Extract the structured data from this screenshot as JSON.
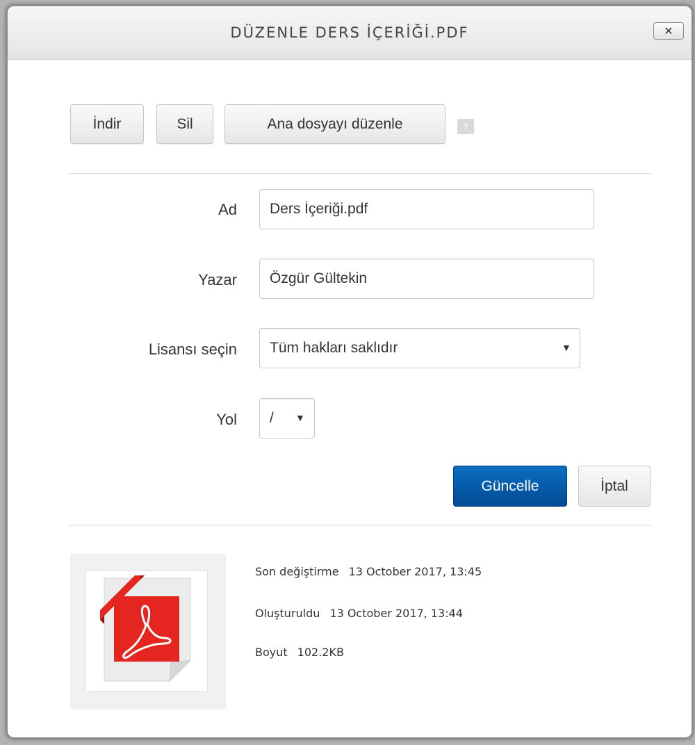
{
  "dialog": {
    "title": "DÜZENLE DERS İÇERİĞİ.PDF",
    "close_label": "✕"
  },
  "toolbar": {
    "download_label": "İndir",
    "delete_label": "Sil",
    "set_main_label": "Ana dosyayı düzenle",
    "help_icon": "question-icon",
    "help_glyph": "?"
  },
  "form": {
    "name_label": "Ad",
    "name_value": "Ders İçeriği.pdf",
    "author_label": "Yazar",
    "author_value": "Özgür Gültekin",
    "license_label": "Lisansı seçin",
    "license_value": "Tüm hakları saklıdır",
    "path_label": "Yol",
    "path_value": "/",
    "dropdown_arrow": "▼"
  },
  "actions": {
    "update_label": "Güncelle",
    "cancel_label": "İptal",
    "primary_color": "#0560b0"
  },
  "file_info": {
    "icon": "pdf-file-icon",
    "modified_label": "Son değiştirme",
    "modified_value": "13 October 2017, 13:45",
    "created_label": "Oluşturuldu",
    "created_value": "13 October 2017, 13:44",
    "size_label": "Boyut",
    "size_value": "102.2KB",
    "pdf_red": "#e5251f"
  }
}
